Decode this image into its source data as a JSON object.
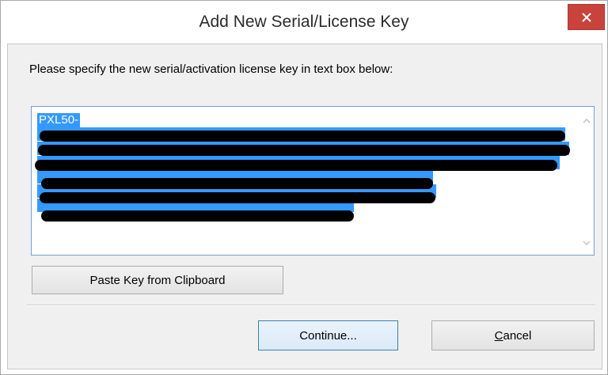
{
  "dialog": {
    "title": "Add New Serial/License Key",
    "close_icon": "close-icon"
  },
  "content": {
    "prompt": "Please specify the new serial/activation license key in text box below:",
    "key_prefix": "PXL50-"
  },
  "buttons": {
    "paste": "Paste Key from Clipboard",
    "continue": "Continue...",
    "cancel": "Cancel"
  },
  "colors": {
    "selection": "#3399ff",
    "close_button": "#c7433c"
  }
}
